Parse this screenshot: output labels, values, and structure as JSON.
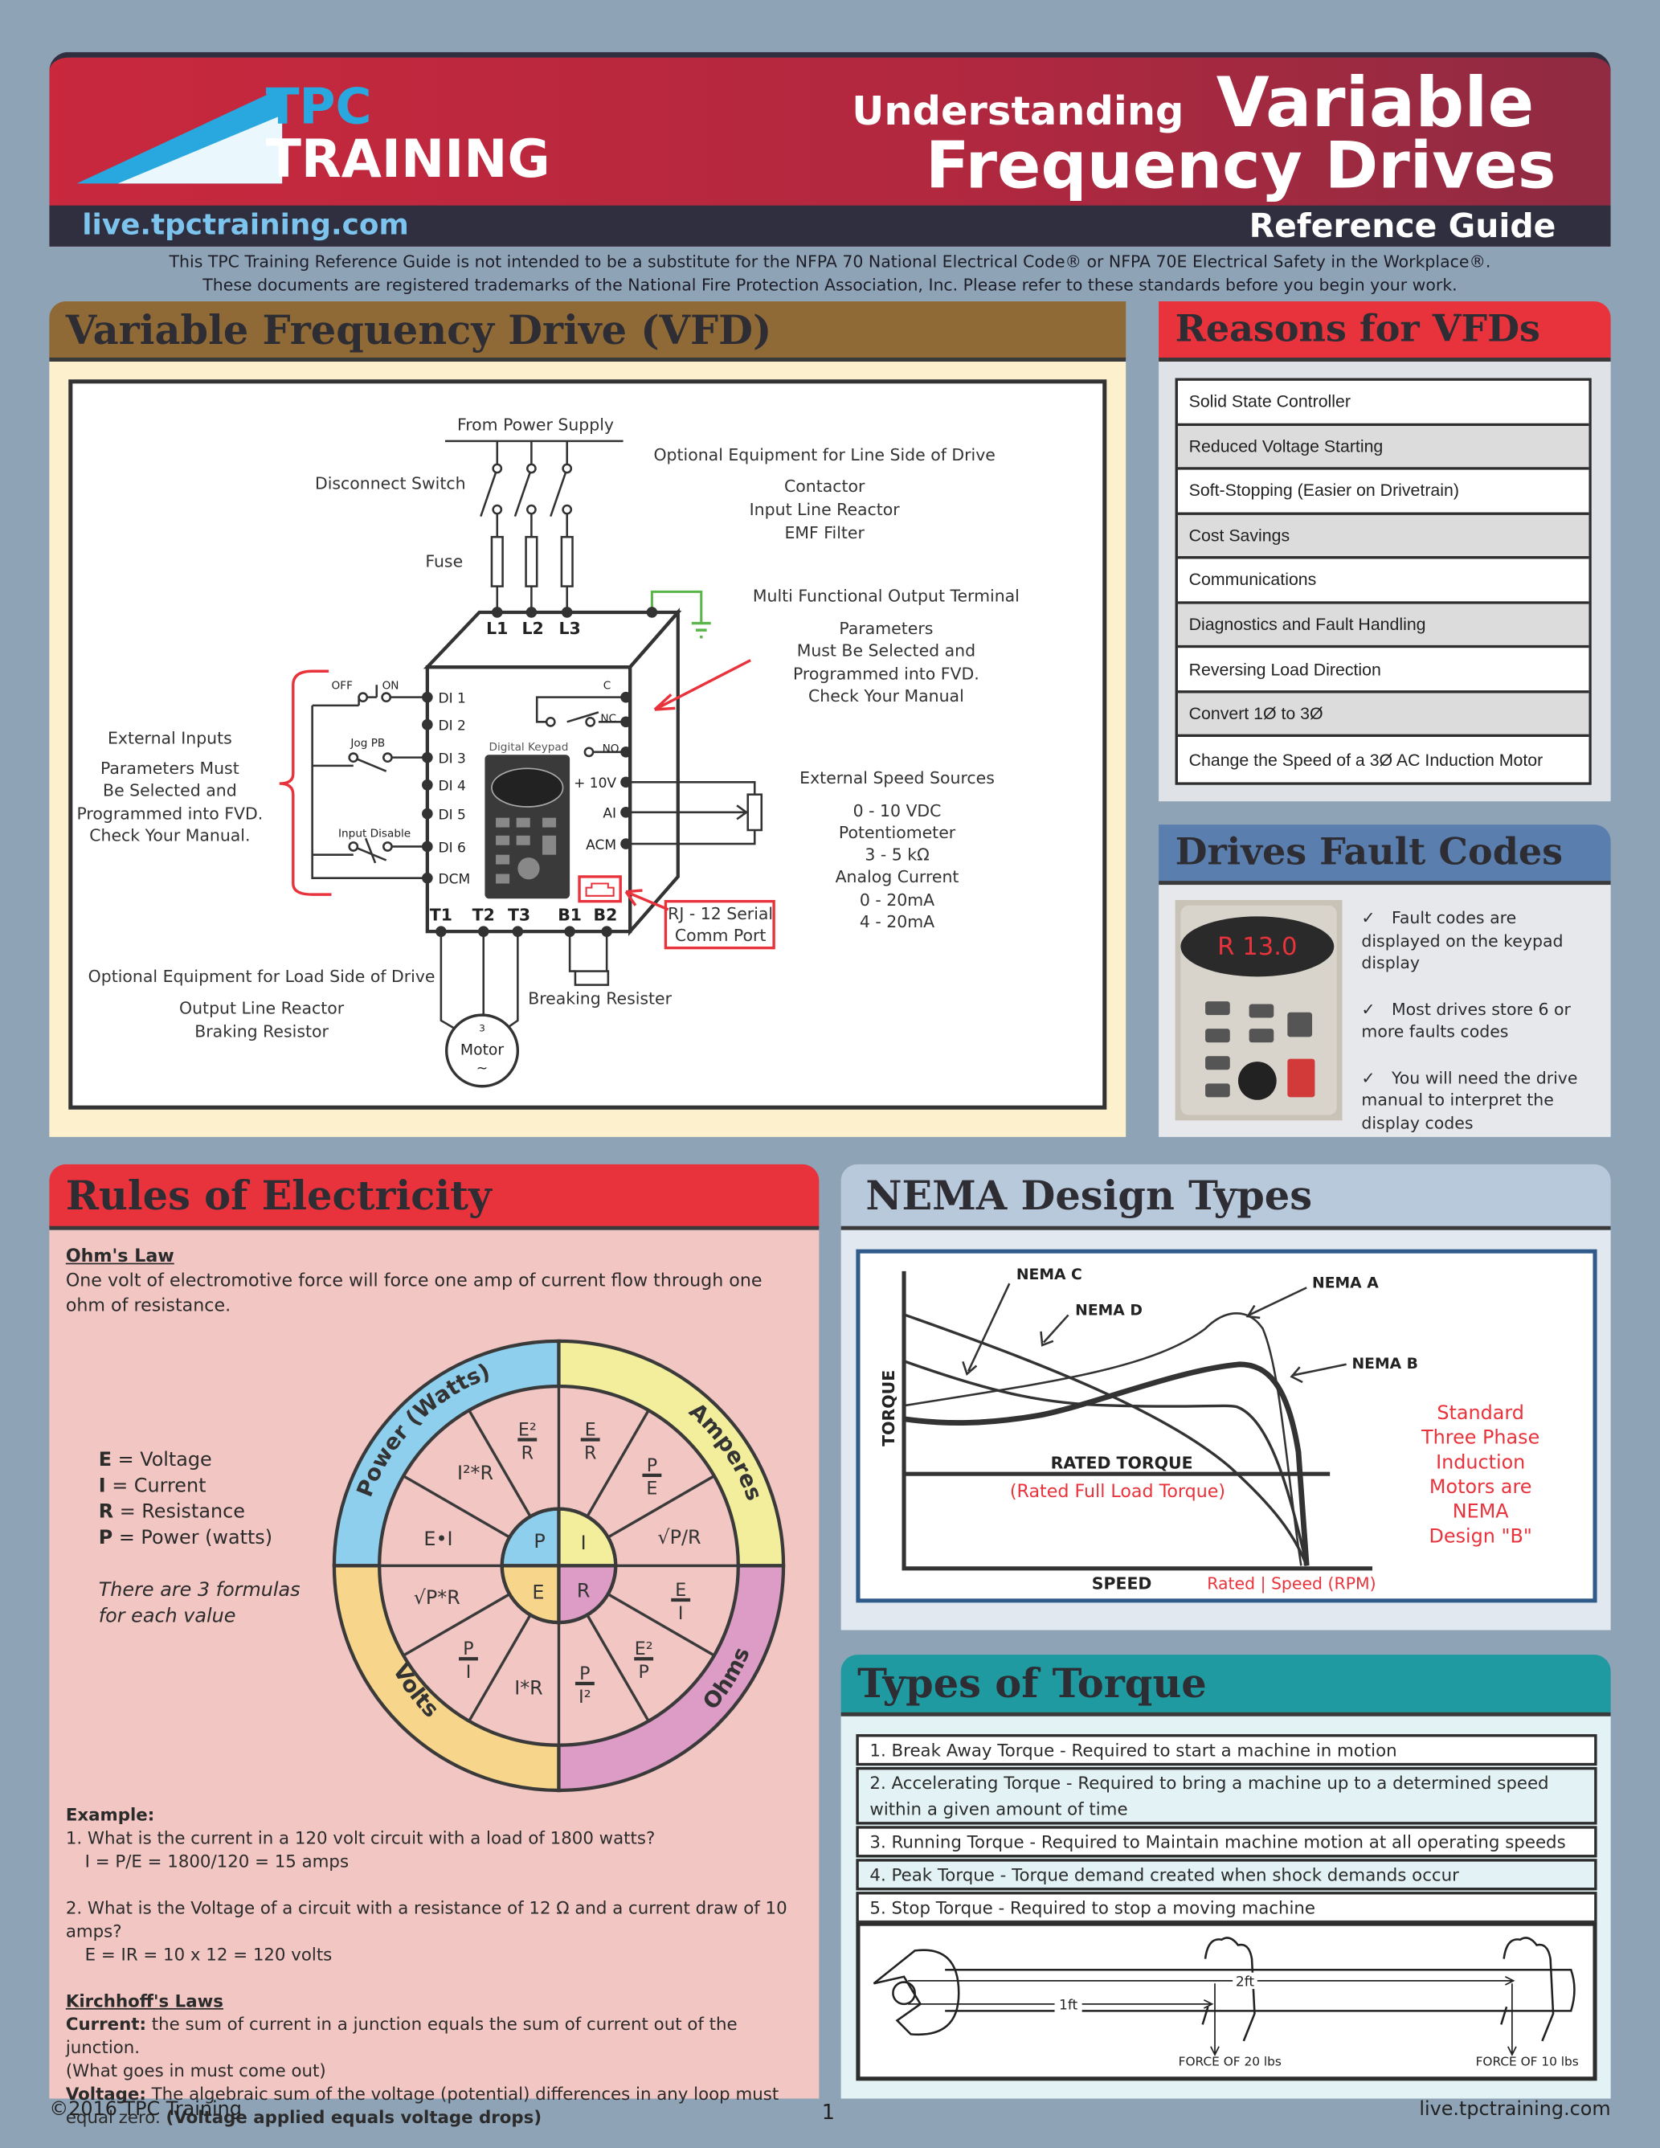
{
  "header": {
    "logo_line1": "TPC",
    "logo_line2": "TRAINING",
    "title_small": "Understanding",
    "title_big1": "Variable",
    "title_big2": "Frequency Drives",
    "url": "live.tpctraining.com",
    "subtitle": "Reference Guide",
    "disclaimer1": "This TPC Training Reference Guide is not intended to be a substitute for the NFPA 70 National Electrical Code® or NFPA 70E Electrical Safety in the Workplace®.",
    "disclaimer2": "These documents are registered trademarks of the National Fire Protection Association, Inc. Please refer to these standards before you begin your work."
  },
  "vfd": {
    "title": "Variable Frequency Drive (VFD)",
    "labels": {
      "power_supply": "From Power Supply",
      "disconnect": "Disconnect Switch",
      "fuse": "Fuse",
      "optional_line": "Optional Equipment for Line Side of Drive",
      "contactor": "Contactor",
      "input_reactor": "Input Line Reactor",
      "emf": "EMF Filter",
      "mfo": "Multi Functional Output Terminal",
      "params1": "Parameters",
      "params2": "Must Be Selected and",
      "params3": "Programmed into FVD.",
      "params4": "Check Your Manual",
      "ext_inputs": "External Inputs",
      "ext1": "Parameters Must",
      "ext2": "Be Selected and",
      "ext3": "Programmed into FVD.",
      "ext4": "Check Your Manual.",
      "off": "OFF",
      "on": "ON",
      "jog": "Jog PB",
      "input_disable": "Input Disable",
      "keypad": "Digital Keypad",
      "speed_sources": "External Speed Sources",
      "s1": "0 - 10 VDC",
      "s2": "Potentiometer",
      "s3": "3 - 5 kΩ",
      "s4": "Analog Current",
      "s5": "0 - 20mA",
      "s6": "4 - 20mA",
      "rj1": "RJ - 12 Serial",
      "rj2": "Comm Port",
      "optional_load": "Optional Equipment for Load Side of Drive",
      "output_reactor": "Output Line Reactor",
      "braking_resistor": "Braking Resistor",
      "breaking_resister": "Breaking Resister",
      "motor": "Motor",
      "motor_phase": "3"
    },
    "terminals_line": [
      "L1",
      "L2",
      "L3"
    ],
    "terminals_left": [
      "DI 1",
      "DI 2",
      "DI 3",
      "DI 4",
      "DI 5",
      "DI 6",
      "DCM"
    ],
    "terminals_right": [
      "C",
      "NC",
      "NO",
      "+ 10V",
      "AI",
      "ACM"
    ],
    "terminals_bottom": [
      "T1",
      "T2",
      "T3",
      "B1",
      "B2"
    ]
  },
  "reasons": {
    "title": "Reasons for VFDs",
    "items": [
      "Solid State Controller",
      "Reduced Voltage Starting",
      "Soft-Stopping (Easier on Drivetrain)",
      "Cost Savings",
      "Communications",
      "Diagnostics and Fault Handling",
      "Reversing Load Direction",
      "Convert 1Ø to 3Ø",
      "Change the Speed of a 3Ø AC Induction Motor"
    ]
  },
  "faults": {
    "title": "Drives Fault Codes",
    "display": "R 13.0",
    "check": "✓",
    "items": [
      "Fault codes are displayed on the keypad display",
      "Most drives store 6 or more faults codes",
      "You will need the drive manual to interpret  the display codes"
    ]
  },
  "rules": {
    "title": "Rules of Electricity",
    "ohms_title": "Ohm's Law",
    "ohms_text": "One volt of electromotive force will force one amp of current flow through one ohm of resistance.",
    "legend": [
      {
        "sym": "E",
        "desc": " = Voltage"
      },
      {
        "sym": "I",
        "desc": " = Current"
      },
      {
        "sym": "R",
        "desc": " = Resistance"
      },
      {
        "sym": "P",
        "desc": " = Power (watts)"
      }
    ],
    "note1": "There are 3 formulas",
    "note2": "for each value",
    "wheel": {
      "ring": [
        "Power (Watts)",
        "Amperes",
        "Volts",
        "Ohms"
      ],
      "center": [
        "P",
        "I",
        "E",
        "R"
      ],
      "colors": {
        "power": "#8fcfee",
        "amperes": "#f2ee9c",
        "volts": "#f7d68c",
        "ohms": "#dc9cc6",
        "inner": "#f1c6c3"
      },
      "formulas": {
        "e2r_num": "E²",
        "e2r_den": "R",
        "i2r": "I²*R",
        "ei": "E•I",
        "er_num": "E",
        "er_den": "R",
        "pe_num": "P",
        "pe_den": "E",
        "sqrt_pr": "√P/R",
        "sqrt_pxr": "√P*R",
        "pi_num": "P",
        "pi_den": "I",
        "ir": "I*R",
        "pi2_num": "P",
        "pi2_den": "I²",
        "e2p_num": "E²",
        "e2p_den": "P",
        "ei2_num": "E",
        "ei2_den": "I"
      }
    },
    "example_title": "Example:",
    "ex1_q": "1. What is the current in a 120 volt circuit with a load of 1800 watts?",
    "ex1_a": "I = P/E = 1800/120 = 15 amps",
    "ex2_q": "2. What is the Voltage of a circuit with a resistance of 12 Ω and a current draw of 10 amps?",
    "ex2_a": "E = IR = 10 x 12 = 120 volts",
    "kirchhoff_title": "Kirchhoff's Laws",
    "current_label": "Current:",
    "current_text": " the sum of current in a junction equals the sum of current out of the junction.",
    "current_note": "(What goes in must come out)",
    "voltage_label": "Voltage:",
    "voltage_text": " The algebraic sum of the voltage (potential) differences in any loop must equal zero. ",
    "voltage_note": "(Voltage applied equals voltage drops)"
  },
  "nema": {
    "title": "NEMA Design Types",
    "y_label": "TORQUE",
    "x_label": "SPEED",
    "x_note": "Rated | Speed (RPM)",
    "rated": "RATED TORQUE",
    "rated_note": "(Rated Full Load Torque)",
    "curves": [
      "NEMA A",
      "NEMA B",
      "NEMA C",
      "NEMA D"
    ],
    "side_note": [
      "Standard",
      "Three Phase",
      "Induction",
      "Motors are",
      "NEMA",
      "Design \"B\""
    ]
  },
  "torque": {
    "title": "Types of Torque",
    "items": [
      "1. Break Away Torque - Required to start a machine in motion",
      "2. Accelerating Torque - Required to bring a machine up to a determined speed within a given amount of time",
      "3. Running Torque - Required to Maintain machine motion at all operating speeds",
      "4. Peak Torque - Torque demand created when shock demands occur",
      "5. Stop Torque - Required to stop a moving machine"
    ],
    "wrench": {
      "d1": "1ft",
      "d2": "2ft",
      "f1": "FORCE OF 20 lbs",
      "f2": "FORCE OF 10 lbs"
    }
  },
  "footer": {
    "copyright": "©2016 TPC Training",
    "page": "1",
    "url": "live.tpctraining.com"
  }
}
